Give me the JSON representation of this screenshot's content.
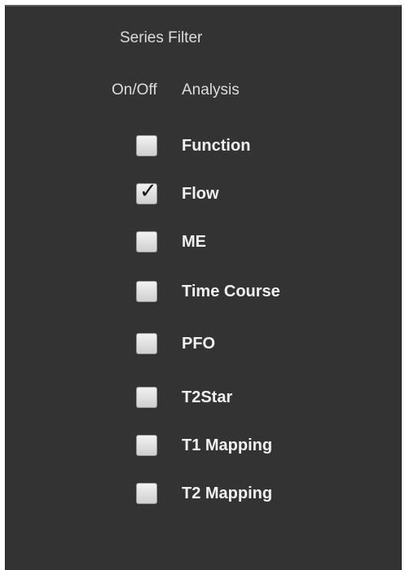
{
  "panel": {
    "title": "Series Filter",
    "columns": {
      "on_off": "On/Off",
      "analysis": "Analysis"
    }
  },
  "analyses": [
    {
      "label": "Function",
      "checked": false
    },
    {
      "label": "Flow",
      "checked": true
    },
    {
      "label": "ME",
      "checked": false
    },
    {
      "label": "Time Course",
      "checked": false
    },
    {
      "label": "PFO",
      "checked": false
    },
    {
      "label": "T2Star",
      "checked": false
    },
    {
      "label": "T1 Mapping",
      "checked": false
    },
    {
      "label": "T2 Mapping",
      "checked": false
    }
  ],
  "colors": {
    "panel_background": "#333333",
    "label_text": "#f0f0f0",
    "checkbox": "#e6e6e6"
  },
  "icons": {
    "check": "check-icon"
  }
}
